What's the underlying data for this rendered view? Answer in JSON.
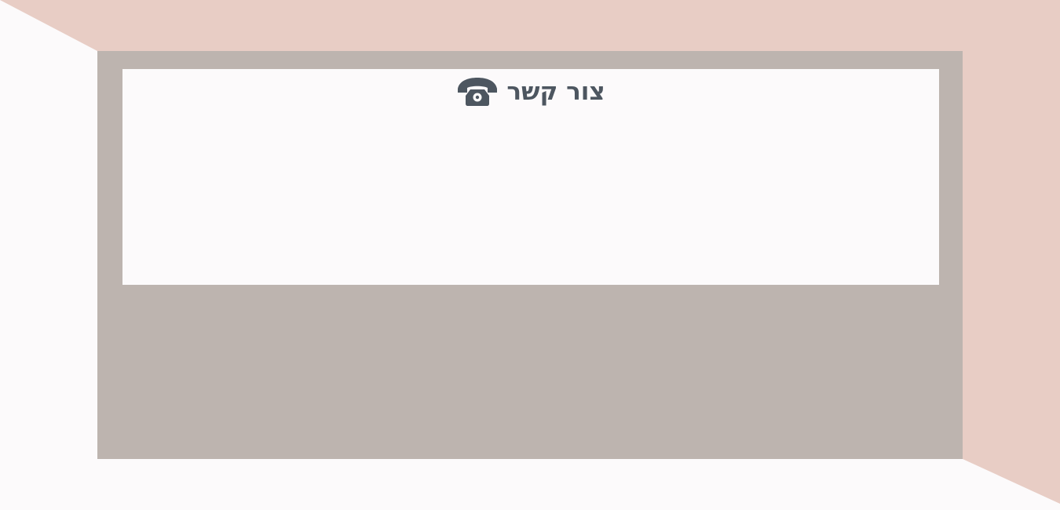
{
  "contact": {
    "title": "צור קשר",
    "icon": "telephone-icon"
  },
  "colors": {
    "page_background": "#fcfafb",
    "accent_shape": "#e8cdc5",
    "panel": "#bdb4af",
    "card": "#fcfafb",
    "heading_text": "#4d5660"
  }
}
